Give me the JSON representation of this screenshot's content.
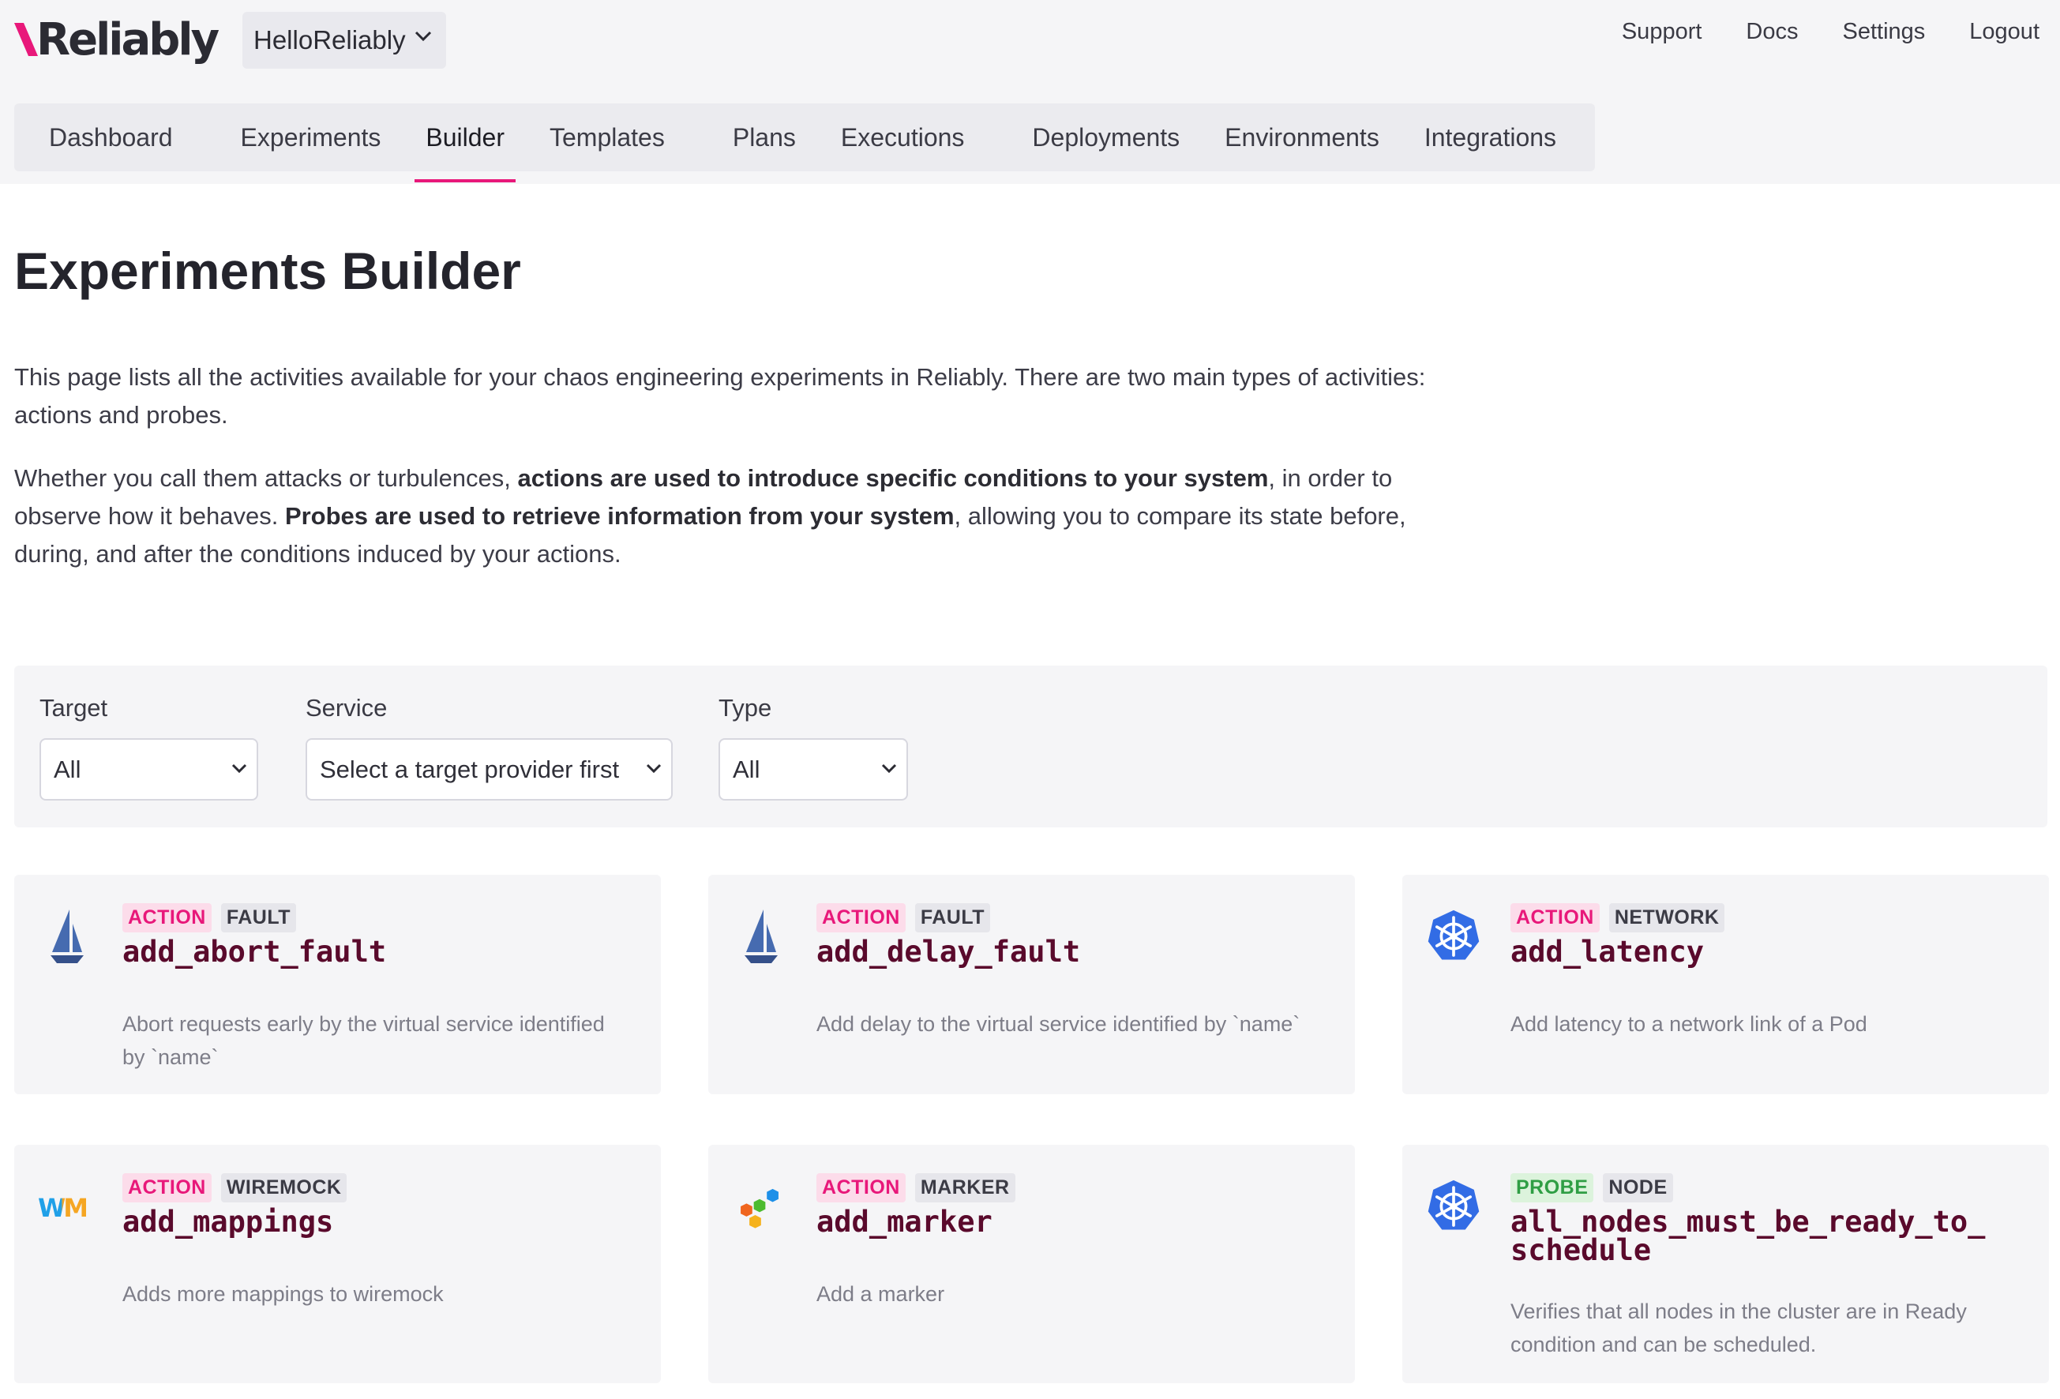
{
  "header": {
    "logo_text": "Reliably",
    "org": "HelloReliably",
    "links": [
      "Support",
      "Docs",
      "Settings",
      "Logout"
    ]
  },
  "nav": {
    "items": [
      "Dashboard",
      "Experiments",
      "Builder",
      "Templates",
      "Plans",
      "Executions",
      "Deployments",
      "Environments",
      "Integrations"
    ],
    "active": "Builder"
  },
  "page": {
    "title": "Experiments Builder",
    "intro_p1": "This page lists all the activities available for your chaos engineering experiments in Reliably. There are two main types of activities: actions and probes.",
    "intro_p2_a": "Whether you call them attacks or turbulences, ",
    "intro_p2_b": "actions are used to introduce specific conditions to your system",
    "intro_p2_c": ", in order to observe how it behaves. ",
    "intro_p2_d": "Probes are used to retrieve information from your system",
    "intro_p2_e": ", allowing you to compare its state before, during, and after the conditions induced by your actions."
  },
  "filters": {
    "target": {
      "label": "Target",
      "value": "All"
    },
    "service": {
      "label": "Service",
      "value": "Select a target provider first"
    },
    "type": {
      "label": "Type",
      "value": "All"
    }
  },
  "cards": [
    {
      "type": "ACTION",
      "kind": "FAULT",
      "name": "add_abort_fault",
      "desc": "Abort requests early by the virtual service identified by `name`",
      "icon": "istio-sail-icon"
    },
    {
      "type": "ACTION",
      "kind": "FAULT",
      "name": "add_delay_fault",
      "desc": "Add delay to the virtual service identified by `name`",
      "icon": "istio-sail-icon"
    },
    {
      "type": "ACTION",
      "kind": "NETWORK",
      "name": "add_latency",
      "desc": "Add latency to a network link of a Pod",
      "icon": "kubernetes-icon"
    },
    {
      "type": "ACTION",
      "kind": "WIREMOCK",
      "name": "add_mappings",
      "desc": "Adds more mappings to wiremock",
      "icon": "wiremock-icon",
      "icon_text": "WM"
    },
    {
      "type": "ACTION",
      "kind": "MARKER",
      "name": "add_marker",
      "desc": "Add a marker",
      "icon": "hexagons-icon"
    },
    {
      "type": "PROBE",
      "kind": "NODE",
      "name": "all_nodes_must_be_ready_to_\nschedule",
      "desc": "Verifies that all nodes in the cluster are in Ready condition and can be scheduled.",
      "icon": "kubernetes-icon"
    }
  ],
  "colors": {
    "accent": "#e8187a",
    "probe": "#2f9e44",
    "name": "#5a0a2c"
  }
}
